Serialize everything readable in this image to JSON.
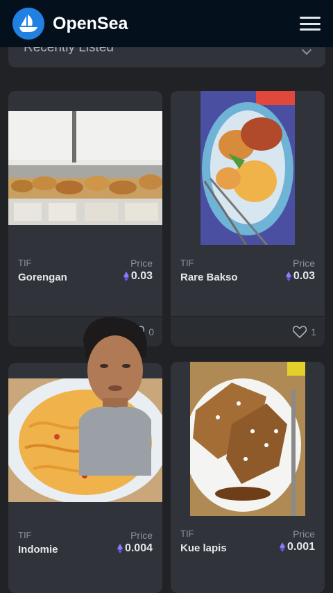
{
  "header": {
    "brand": "OpenSea",
    "logo_icon": "sailboat-icon",
    "menu_icon": "hamburger-menu-icon"
  },
  "sort": {
    "selected": "Recently Listed"
  },
  "cards": [
    {
      "collection": "TIF",
      "name": "Gorengan",
      "price_label": "Price",
      "price": "0.03",
      "likes": "0"
    },
    {
      "collection": "TIF",
      "name": "Rare Bakso",
      "price_label": "Price",
      "price": "0.03",
      "likes": "1"
    },
    {
      "collection": "TIF",
      "name": "Indomie",
      "price_label": "Price",
      "price": "0.004"
    },
    {
      "collection": "TIF",
      "name": "Kue lapis",
      "price_label": "Price",
      "price": "0.001"
    }
  ],
  "colors": {
    "header_bg": "#04111d",
    "brand_blue": "#2081e2",
    "card_bg": "#303339",
    "eth_purple": "#8a7bff"
  }
}
